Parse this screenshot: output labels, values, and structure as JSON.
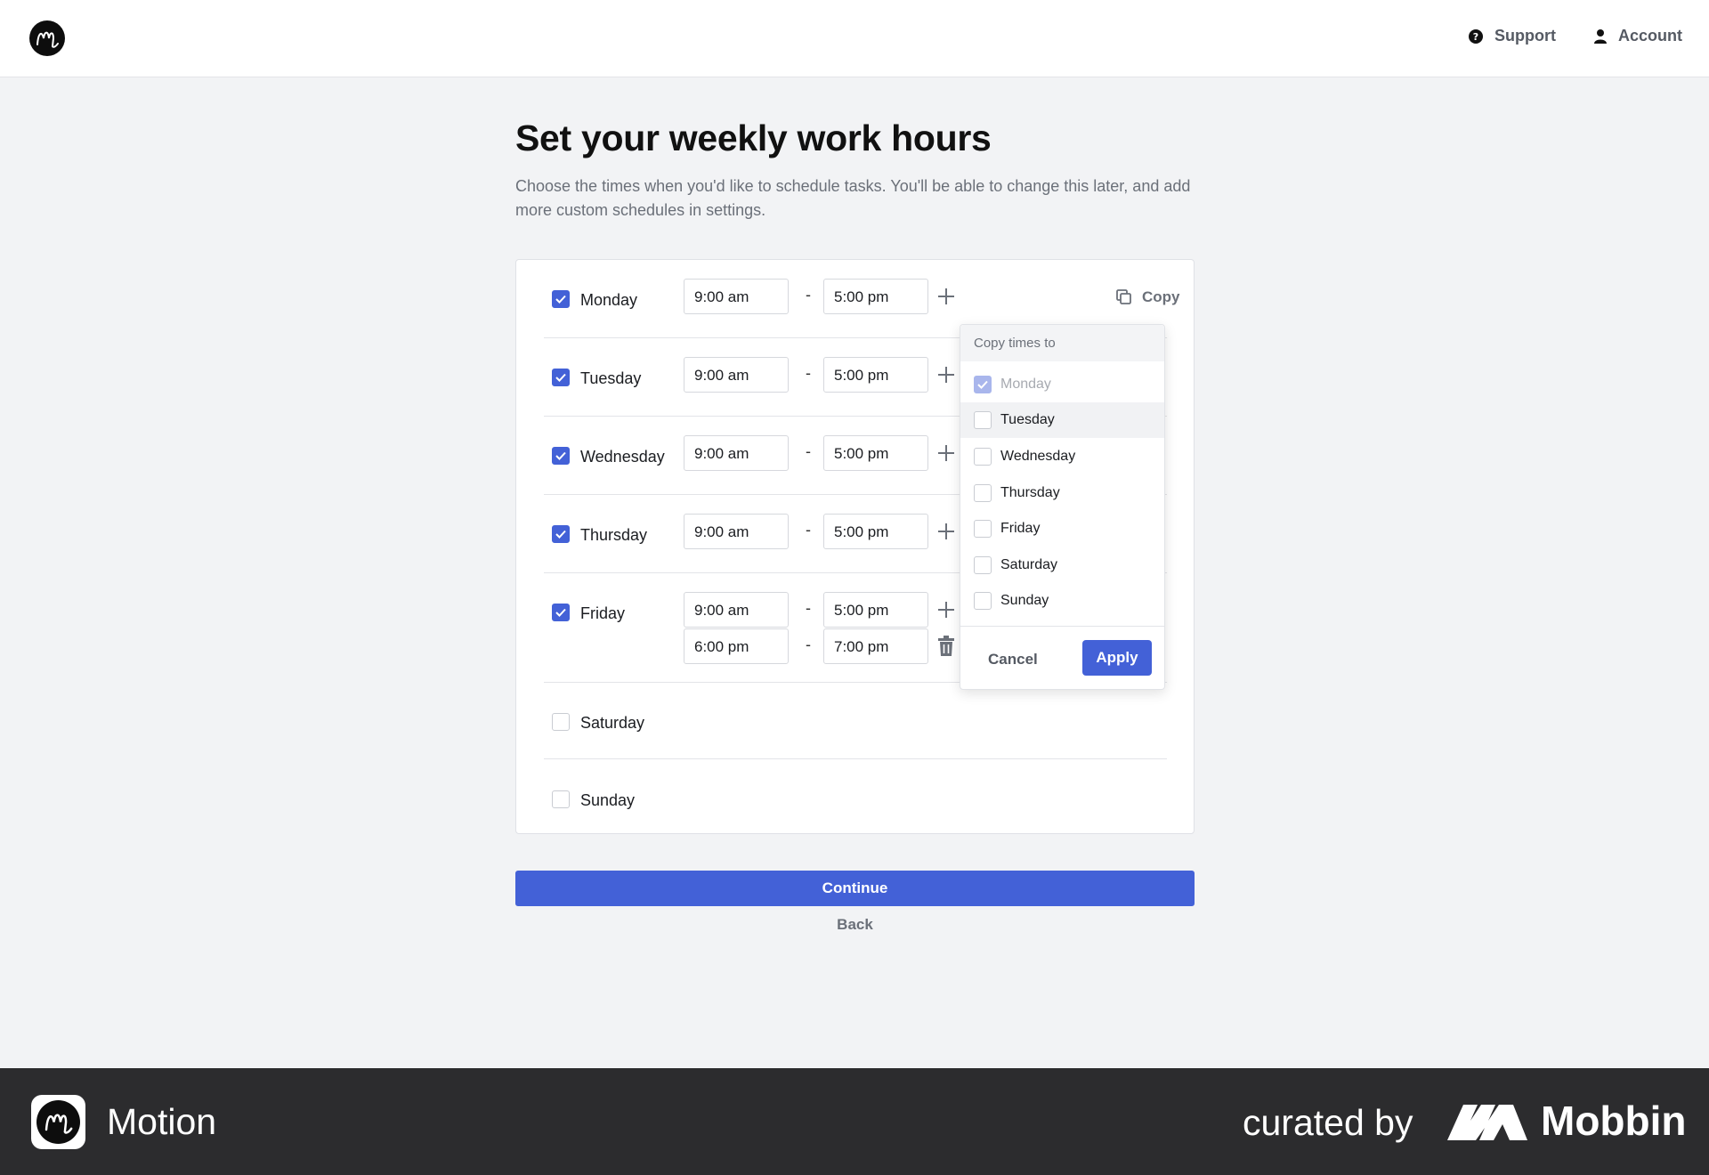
{
  "header": {
    "support": "Support",
    "account": "Account"
  },
  "page": {
    "title": "Set your weekly work hours",
    "subtitle": "Choose the times when you'd like to schedule tasks. You'll be able to change this later, and add more custom schedules in settings."
  },
  "days": [
    {
      "name": "Monday",
      "checked": true,
      "slots": [
        [
          "9:00 am",
          "5:00 pm"
        ]
      ]
    },
    {
      "name": "Tuesday",
      "checked": true,
      "slots": [
        [
          "9:00 am",
          "5:00 pm"
        ]
      ]
    },
    {
      "name": "Wednesday",
      "checked": true,
      "slots": [
        [
          "9:00 am",
          "5:00 pm"
        ]
      ]
    },
    {
      "name": "Thursday",
      "checked": true,
      "slots": [
        [
          "9:00 am",
          "5:00 pm"
        ]
      ]
    },
    {
      "name": "Friday",
      "checked": true,
      "slots": [
        [
          "9:00 am",
          "5:00 pm"
        ],
        [
          "6:00 pm",
          "7:00 pm"
        ]
      ]
    },
    {
      "name": "Saturday",
      "checked": false,
      "slots": []
    },
    {
      "name": "Sunday",
      "checked": false,
      "slots": []
    }
  ],
  "separator": "-",
  "copy_label": "Copy",
  "copy_menu": {
    "heading": "Copy times to",
    "items": [
      "Monday",
      "Tuesday",
      "Wednesday",
      "Thursday",
      "Friday",
      "Saturday",
      "Sunday"
    ],
    "cancel": "Cancel",
    "apply": "Apply"
  },
  "actions": {
    "continue": "Continue",
    "back": "Back"
  },
  "footer": {
    "app_name": "Motion",
    "curated_by": "curated by",
    "brand": "Mobbin"
  },
  "colors": {
    "accent": "#4361d7",
    "background": "#f2f3f5",
    "footer": "#2c2c2e"
  }
}
